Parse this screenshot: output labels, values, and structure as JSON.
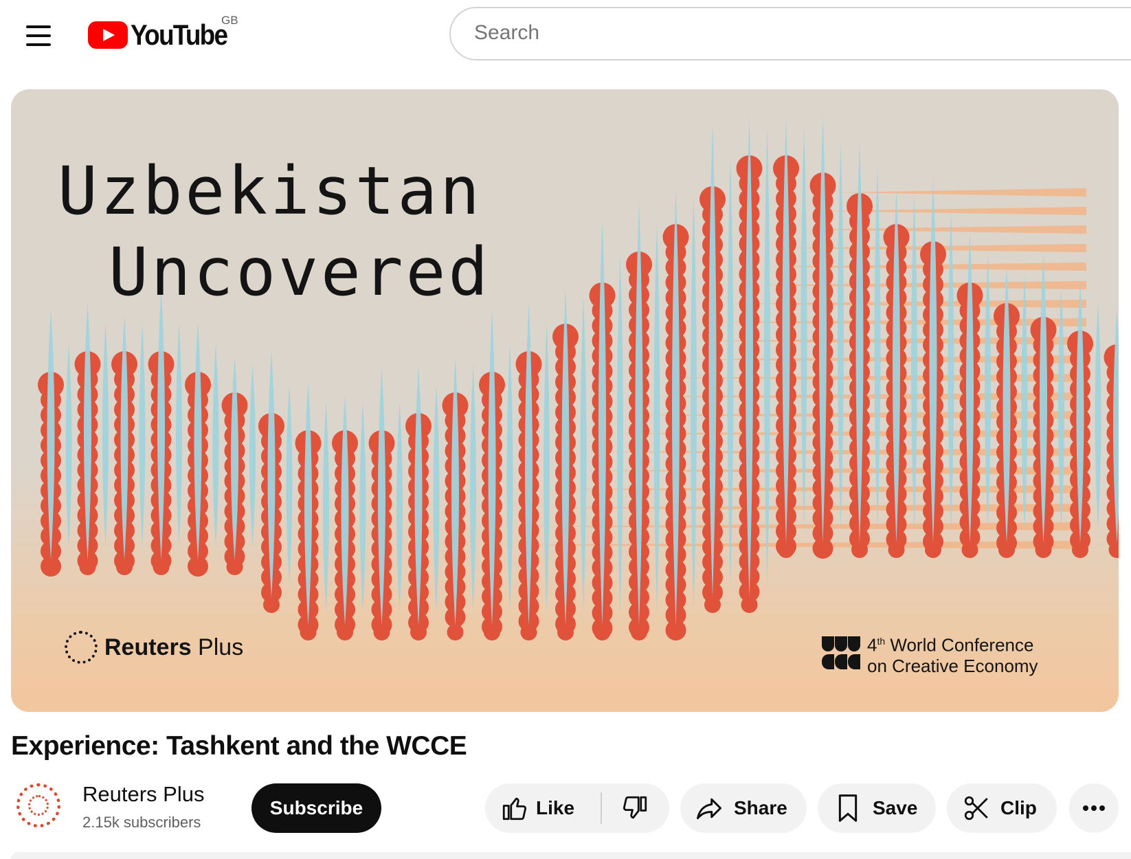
{
  "header": {
    "menu_icon": "hamburger-menu-icon",
    "logo_text": "YouTube",
    "region": "GB",
    "search_placeholder": "Search"
  },
  "thumbnail": {
    "title_line1": "Uzbekistan",
    "title_line2": "Uncovered",
    "brand_left_bold": "Reuters",
    "brand_left_light": " Plus",
    "brand_right_ordinal": "4",
    "brand_right_sup": "th",
    "brand_right_line1_rest": "World Conference",
    "brand_right_line2": "on Creative Economy",
    "colors": {
      "background": "#dcd5cc",
      "bottom_fade": "#f3c69d",
      "red": "#e0523a",
      "blue": "#9fd3dd",
      "peach": "#f2b486"
    }
  },
  "video": {
    "title": "Experience: Tashkent and the WCCE"
  },
  "channel": {
    "name": "Reuters Plus",
    "subscribers": "2.15k subscribers",
    "subscribe_label": "Subscribe"
  },
  "actions": {
    "like_label": "Like",
    "share_label": "Share",
    "save_label": "Save",
    "clip_label": "Clip",
    "more_icon": "more-horizontal-icon"
  }
}
